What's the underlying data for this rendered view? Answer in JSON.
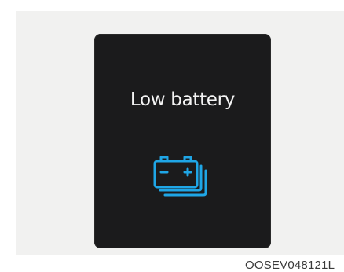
{
  "display": {
    "message": "Low battery",
    "icon": "battery-warning-icon",
    "icon_color": "#1fa6e6",
    "background_color": "#1b1b1c"
  },
  "figure": {
    "caption": "OOSEV048121L"
  }
}
